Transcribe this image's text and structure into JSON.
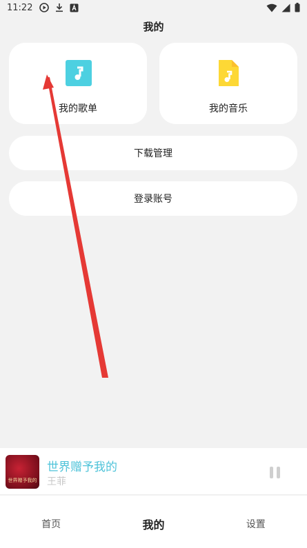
{
  "status_bar": {
    "time": "11:22",
    "left_icons": [
      "play-circle-icon",
      "download-icon",
      "a-box-icon"
    ],
    "right_icons": [
      "wifi-icon",
      "signal-icon",
      "battery-icon"
    ]
  },
  "header": {
    "title": "我的"
  },
  "cards": [
    {
      "label": "我的歌单",
      "icon": "music-note-icon",
      "color": "#4dd0e1"
    },
    {
      "label": "我的音乐",
      "icon": "music-file-icon",
      "color": "#fdd835"
    }
  ],
  "menu": {
    "download_label": "下载管理",
    "login_label": "登录账号"
  },
  "player": {
    "song_title": "世界赠予我的",
    "artist": "王菲",
    "album_art_text": "世界赠予我的",
    "state": "playing"
  },
  "tabs": [
    {
      "label": "首页",
      "active": false
    },
    {
      "label": "我的",
      "active": true
    },
    {
      "label": "设置",
      "active": false
    }
  ],
  "colors": {
    "accent": "#4fc3d9",
    "background": "#f2f2f2",
    "annotation_arrow": "#e53935"
  }
}
